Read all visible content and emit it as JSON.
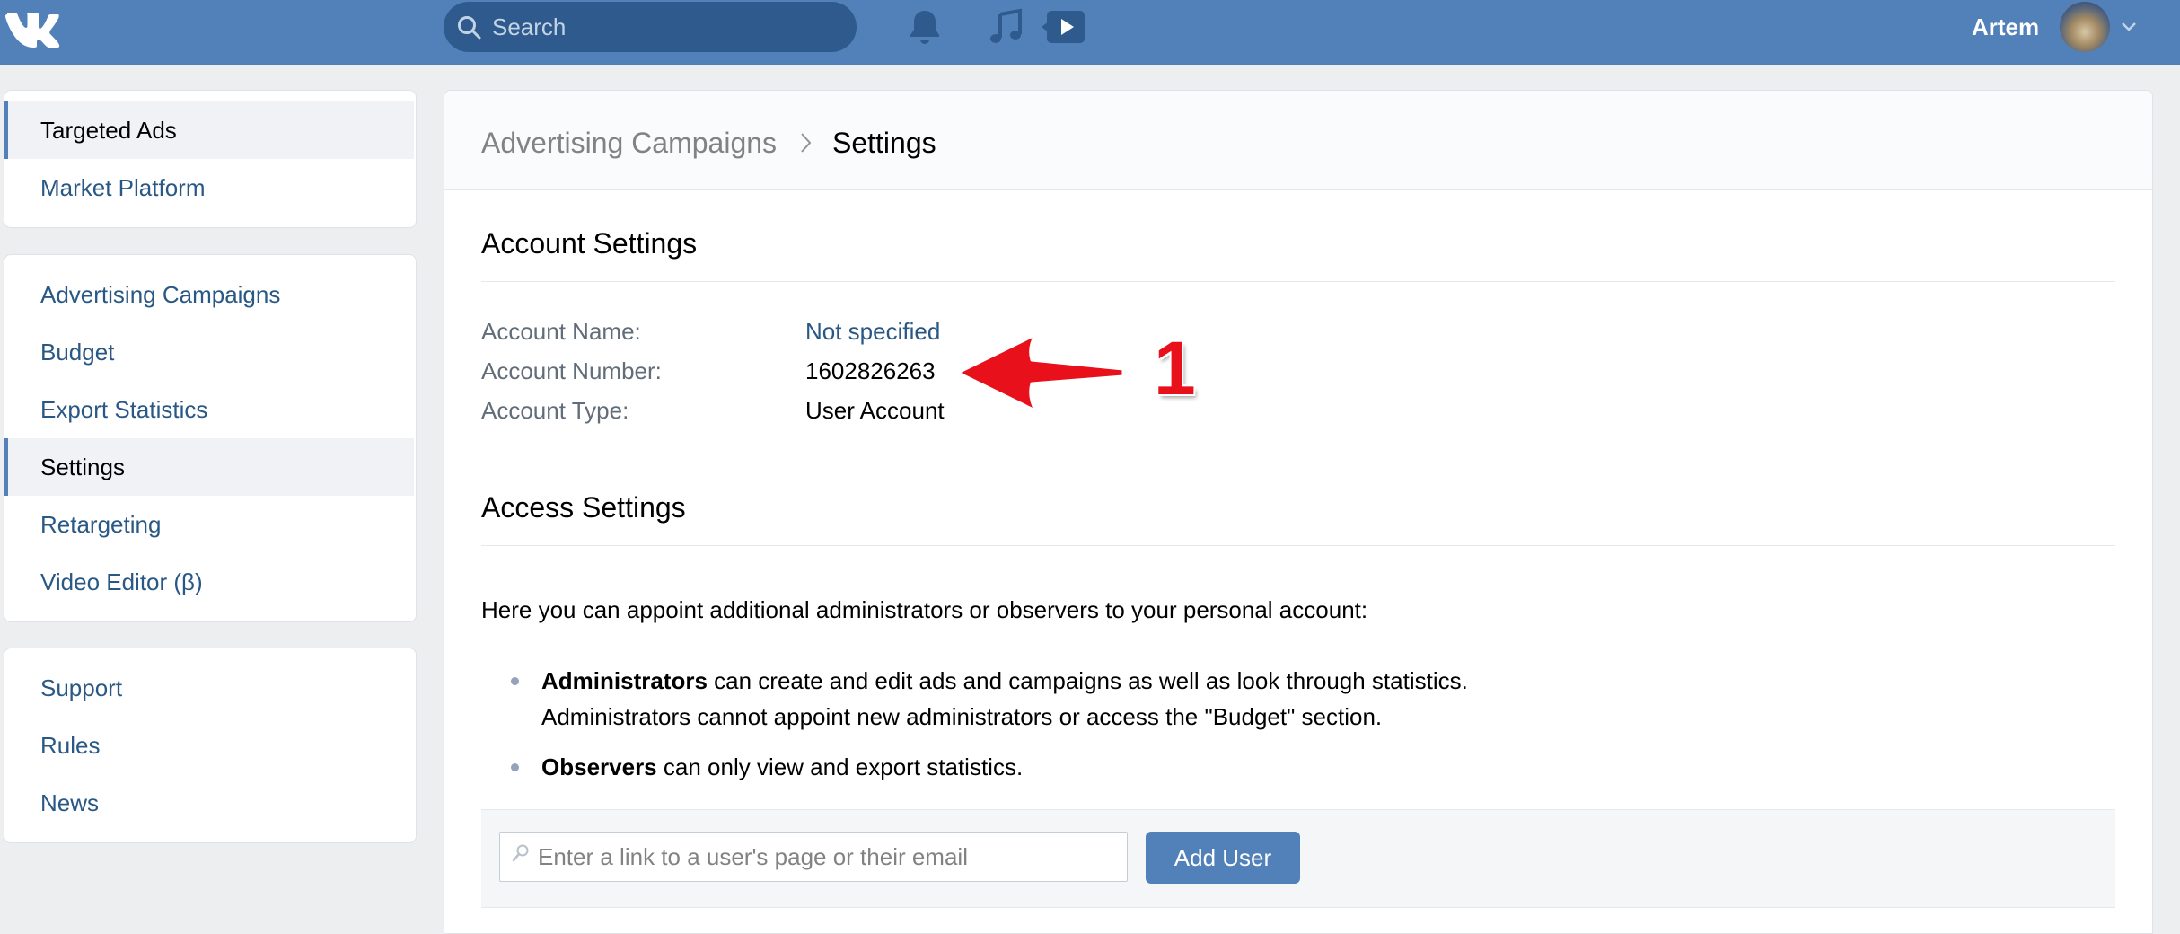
{
  "colors": {
    "header_bg": "#5181b8",
    "search_bg": "#2f5a8d",
    "link": "#2a5885",
    "button": "#5181b8",
    "annotation": "#e8101a"
  },
  "topbar": {
    "search_placeholder": "Search",
    "user_name": "Artem",
    "icons": [
      "vk-logo-icon",
      "search-icon",
      "bell-icon",
      "music-icon",
      "video-icon",
      "chevron-down-icon"
    ]
  },
  "sidebar": {
    "group1": [
      {
        "label": "Targeted Ads",
        "active": true
      },
      {
        "label": "Market Platform",
        "active": false
      }
    ],
    "group2": [
      {
        "label": "Advertising Campaigns",
        "active": false
      },
      {
        "label": "Budget",
        "active": false
      },
      {
        "label": "Export Statistics",
        "active": false
      },
      {
        "label": "Settings",
        "active": true
      },
      {
        "label": "Retargeting",
        "active": false
      },
      {
        "label": "Video Editor (β)",
        "active": false
      }
    ],
    "group3": [
      {
        "label": "Support",
        "active": false
      },
      {
        "label": "Rules",
        "active": false
      },
      {
        "label": "News",
        "active": false
      }
    ]
  },
  "main": {
    "breadcrumb": {
      "parent": "Advertising Campaigns",
      "current": "Settings"
    },
    "account_settings": {
      "title": "Account Settings",
      "fields": [
        {
          "label": "Account Name:",
          "value": "Not specified"
        },
        {
          "label": "Account Number:",
          "value": "1602826263"
        },
        {
          "label": "Account Type:",
          "value": "User Account"
        }
      ]
    },
    "access_settings": {
      "title": "Access Settings",
      "intro": "Here you can appoint additional administrators or observers to your personal account:",
      "admin_bold": "Administrators",
      "admin_text": " can create and edit ads and campaigns as well as look through statistics.",
      "admin_text2": "Administrators cannot appoint new administrators or access the \"Budget\" section.",
      "observer_bold": "Observers",
      "observer_text": " can only view and export statistics.",
      "input_placeholder": "Enter a link to a user's page or their email",
      "add_button": "Add User"
    }
  },
  "annotation": {
    "number": "1"
  }
}
